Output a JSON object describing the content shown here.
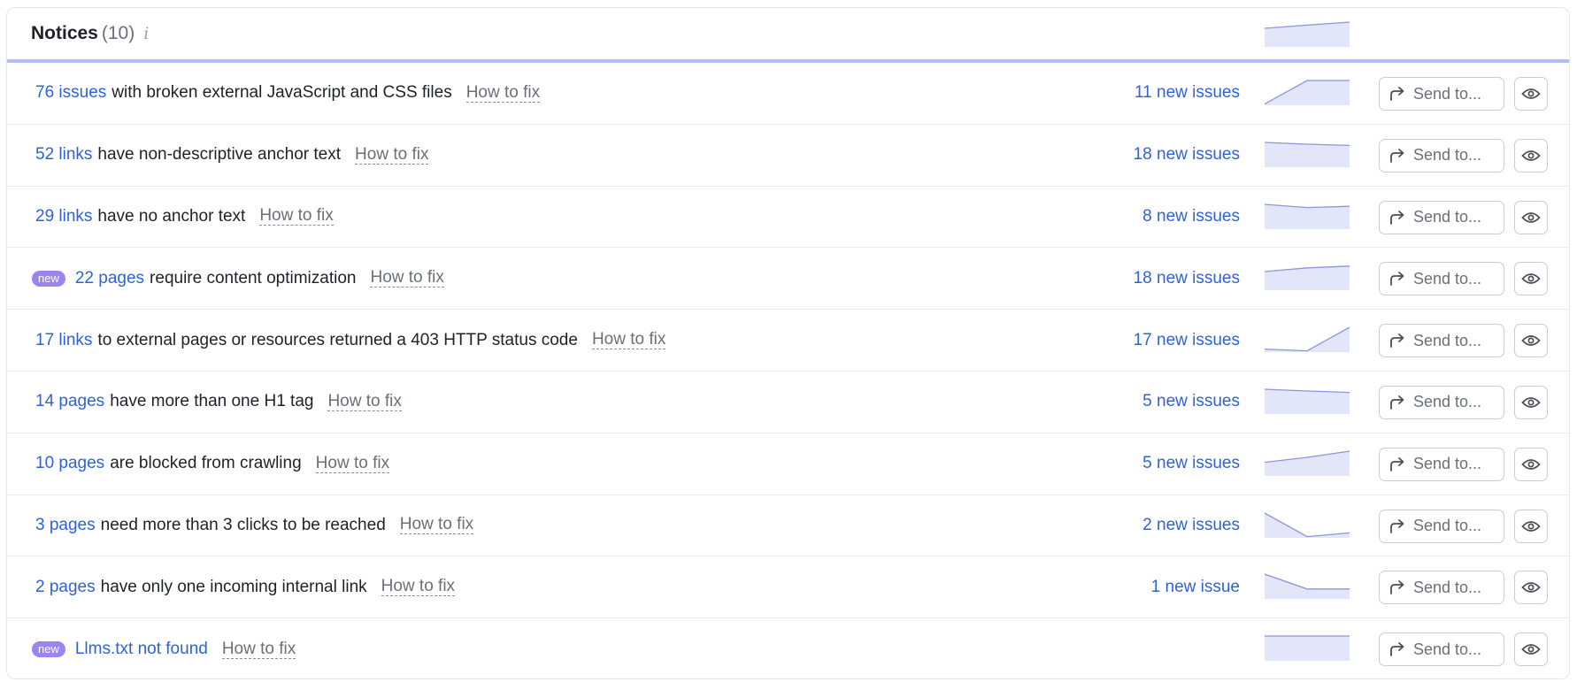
{
  "header": {
    "title": "Notices",
    "count": "(10)",
    "info_icon": "info-icon",
    "trend": [
      0.75,
      0.88,
      1.0
    ]
  },
  "row_actions": {
    "send_label": "Send to...",
    "send_icon": "forward-arrow-icon",
    "view_icon": "eye-icon",
    "howto_label": "How to fix"
  },
  "colors": {
    "link": "#2f62d8",
    "badge": "#9b84f0",
    "spark_fill": "#e3e5f9",
    "spark_line": "#8e95db",
    "header_border": "#b3bdf5"
  },
  "rows": [
    {
      "badge": "",
      "link": "76 issues",
      "desc": "with broken external JavaScript and CSS files",
      "new_issues": "11 new issues",
      "trend": [
        0.05,
        1.0,
        1.0
      ]
    },
    {
      "badge": "",
      "link": "52 links",
      "desc": "have non-descriptive anchor text",
      "new_issues": "18 new issues",
      "trend": [
        1.0,
        0.93,
        0.88
      ]
    },
    {
      "badge": "",
      "link": "29 links",
      "desc": "have no anchor text",
      "new_issues": "8 new issues",
      "trend": [
        1.0,
        0.87,
        0.92
      ]
    },
    {
      "badge": "new",
      "link": "22 pages",
      "desc": "require content optimization",
      "new_issues": "18 new issues",
      "trend": [
        0.75,
        0.9,
        0.97
      ]
    },
    {
      "badge": "",
      "link": "17 links",
      "desc": "to external pages or resources returned a 403 HTTP status code",
      "new_issues": "17 new issues",
      "trend": [
        0.12,
        0.05,
        1.0
      ]
    },
    {
      "badge": "",
      "link": "14 pages",
      "desc": "have more than one H1 tag",
      "new_issues": "5 new issues",
      "trend": [
        1.0,
        0.93,
        0.87
      ]
    },
    {
      "badge": "",
      "link": "10 pages",
      "desc": "are blocked from crawling",
      "new_issues": "5 new issues",
      "trend": [
        0.55,
        0.75,
        1.0
      ]
    },
    {
      "badge": "",
      "link": "3 pages",
      "desc": "need more than 3 clicks to be reached",
      "new_issues": "2 new issues",
      "trend": [
        1.0,
        0.05,
        0.2
      ]
    },
    {
      "badge": "",
      "link": "2 pages",
      "desc": "have only one incoming internal link",
      "new_issues": "1 new issue",
      "trend": [
        1.0,
        0.4,
        0.4
      ]
    },
    {
      "badge": "new",
      "link": "Llms.txt not found",
      "desc": "",
      "new_issues": "",
      "trend": [
        1.0,
        1.0,
        1.0
      ]
    }
  ]
}
